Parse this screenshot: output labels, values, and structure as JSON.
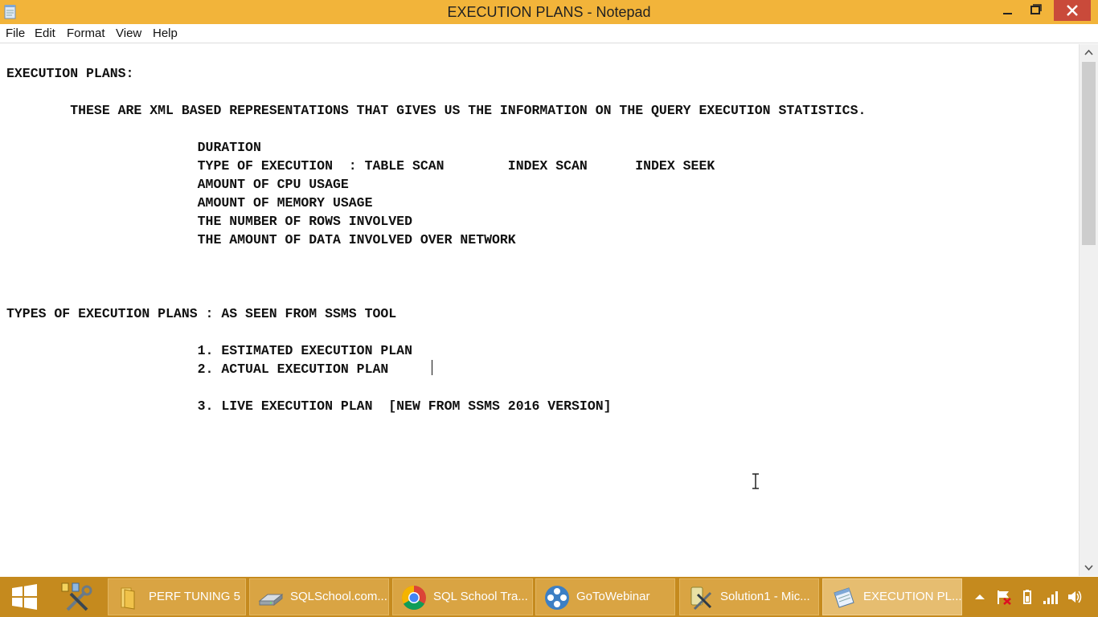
{
  "window": {
    "title": "EXECUTION PLANS - Notepad",
    "colors": {
      "titlebar": "#f2b43a",
      "close": "#c94a3a",
      "taskbar": "#c58a1e"
    }
  },
  "menu": {
    "file": "File",
    "edit": "Edit",
    "format": "Format",
    "view": "View",
    "help": "Help"
  },
  "document": {
    "lines": [
      "EXECUTION PLANS:",
      "        THESE ARE XML BASED REPRESENTATIONS THAT GIVES US THE INFORMATION ON THE QUERY EXECUTION STATISTICS.",
      "                        DURATION",
      "                        TYPE OF EXECUTION  : TABLE SCAN        INDEX SCAN      INDEX SEEK",
      "                        AMOUNT OF CPU USAGE",
      "                        AMOUNT OF MEMORY USAGE",
      "                        THE NUMBER OF ROWS INVOLVED",
      "                        THE AMOUNT OF DATA INVOLVED OVER NETWORK",
      "TYPES OF EXECUTION PLANS : AS SEEN FROM SSMS TOOL",
      "                        1. ESTIMATED EXECUTION PLAN",
      "                        2. ACTUAL EXECUTION PLAN",
      "                        3. LIVE EXECUTION PLAN  [NEW FROM SSMS 2016 VERSION]"
    ]
  },
  "taskbar": {
    "tasks": [
      {
        "label": "PERF TUNING 5",
        "icon": "folder-icon"
      },
      {
        "label": "SQLSchool.com...",
        "icon": "drive-icon"
      },
      {
        "label": "SQL School Tra...",
        "icon": "chrome-icon"
      },
      {
        "label": "GoToWebinar",
        "icon": "gotowebinar-icon"
      },
      {
        "label": "Solution1 - Mic...",
        "icon": "ssms-icon"
      },
      {
        "label": "EXECUTION PL...",
        "icon": "notepad-icon"
      }
    ]
  }
}
